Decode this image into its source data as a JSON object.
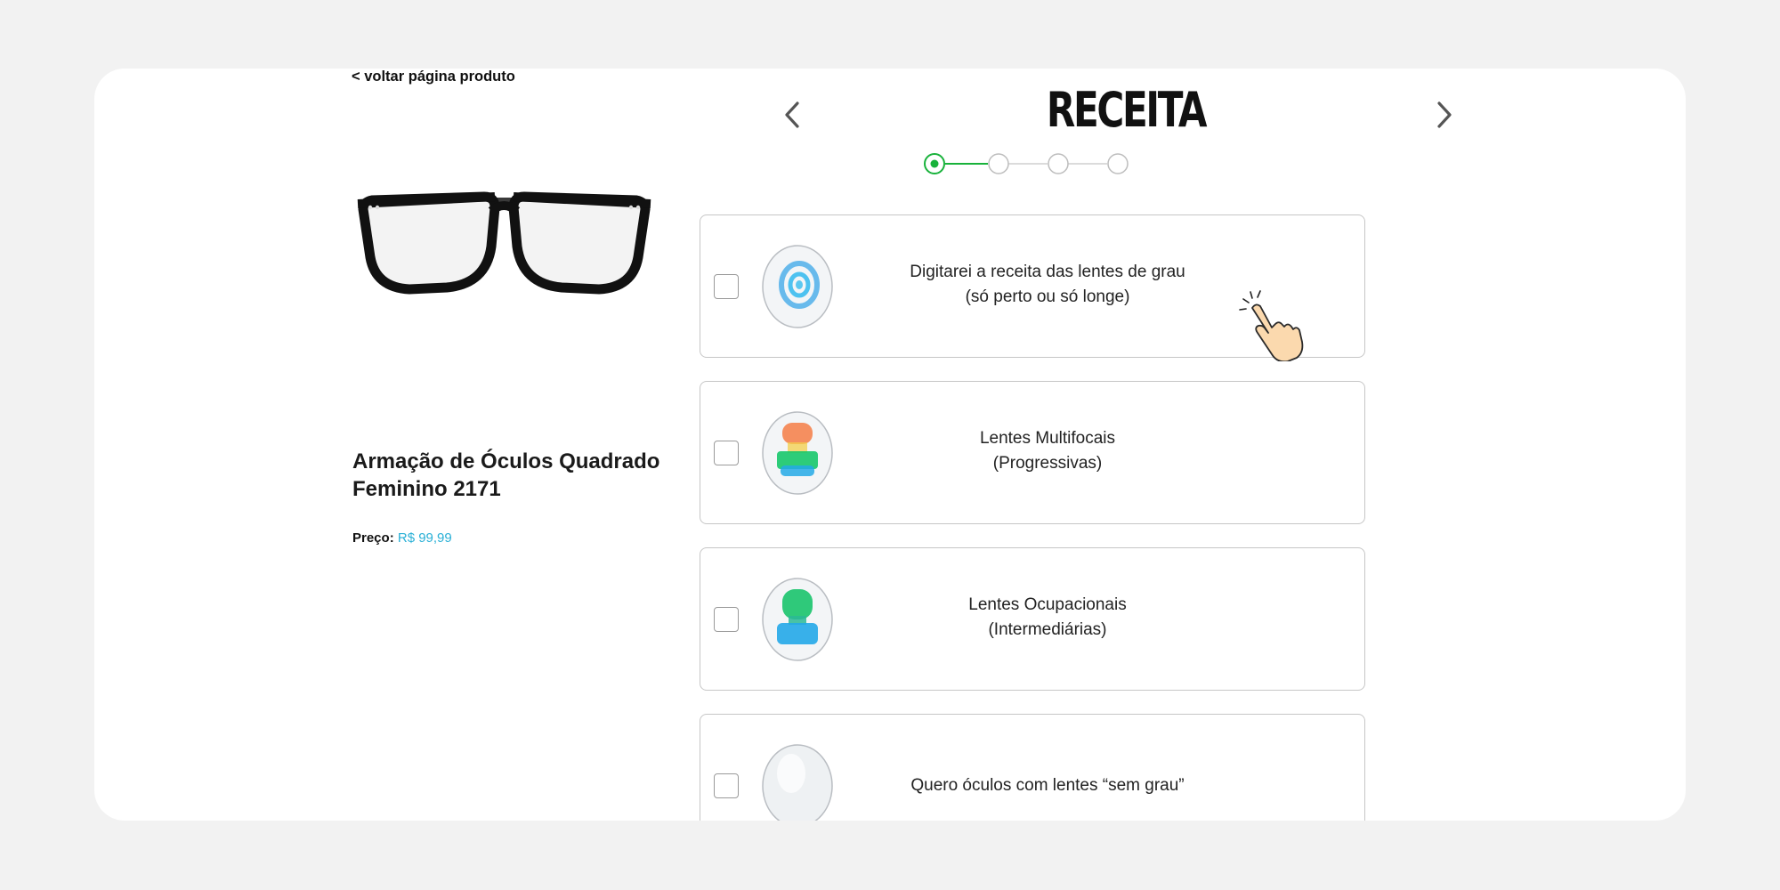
{
  "nav": {
    "back_label": "< voltar página produto"
  },
  "product": {
    "name": "Armação de Óculos Quadrado Feminino 2171",
    "price_label": "Preço:",
    "price_value": "R$ 99,99"
  },
  "step": {
    "title": "RECEITA",
    "current": 1,
    "total": 4
  },
  "options": [
    {
      "line1": "Digitarei a receita das lentes de grau",
      "line2": "(só perto ou só longe)",
      "lens_icon": "single-vision-lens-icon",
      "checked": false
    },
    {
      "line1": "Lentes Multifocais",
      "line2": "(Progressivas)",
      "lens_icon": "multifocal-lens-icon",
      "checked": false
    },
    {
      "line1": "Lentes Ocupacionais",
      "line2": "(Intermediárias)",
      "lens_icon": "occupational-lens-icon",
      "checked": false
    },
    {
      "line1": "Quero óculos com lentes “sem grau”",
      "line2": "",
      "lens_icon": "plain-lens-icon",
      "checked": false
    }
  ],
  "colors": {
    "accent_green": "#18b23b",
    "price_blue": "#2ab0d6",
    "background": "#f2f2f2"
  }
}
